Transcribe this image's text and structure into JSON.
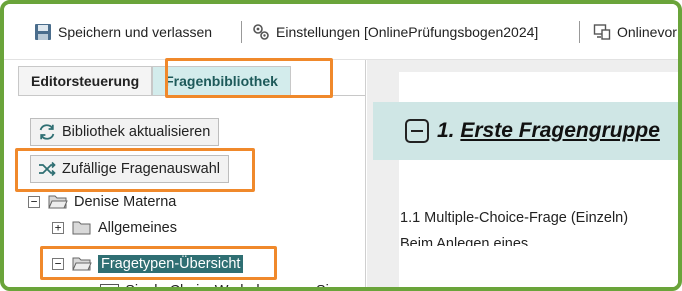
{
  "toolbar": {
    "save_label": "Speichern und verlassen",
    "settings_label": "Einstellungen [OnlinePrüfungsbogen2024]",
    "preview_label": "Onlinevor"
  },
  "left": {
    "tabs": [
      {
        "label": "Editorsteuerung"
      },
      {
        "label": "Fragenbibliothek"
      }
    ],
    "refresh_button": "Bibliothek aktualisieren",
    "random_button": "Zufällige Fragenauswahl",
    "tree": {
      "root": "Denise Materna",
      "child1": "Allgemeines",
      "child2": "Fragetypen-Übersicht",
      "leaf_badge": "SC",
      "leaf": "Single ChoiceWo bekommen Si"
    }
  },
  "right": {
    "group_number": "1.",
    "group_title": "Erste Fragengruppe",
    "question_label": "1.1 Multiple-Choice-Frage (Einzeln)",
    "question_sub": "Beim Anlegen eines"
  },
  "colors": {
    "highlight": "#f0892b",
    "frame": "#6aa43a",
    "selected": "#2f6f73",
    "group_band": "#cfe6e5"
  }
}
